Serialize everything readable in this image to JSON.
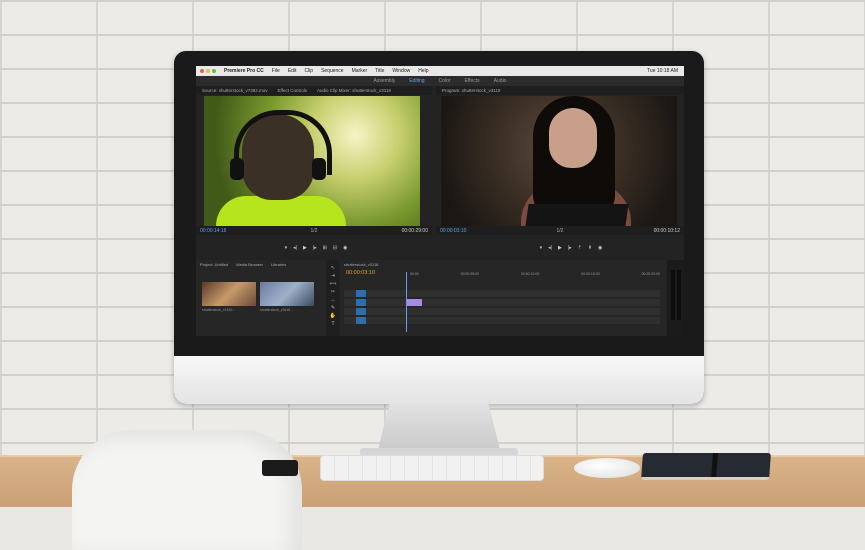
{
  "menu_bar": {
    "app_name": "Premiere Pro CC",
    "items": [
      "File",
      "Edit",
      "Clip",
      "Sequence",
      "Marker",
      "Title",
      "Window",
      "Help"
    ],
    "clock": "Tue 10:18 AM"
  },
  "workspaces": {
    "items": [
      "Assembly",
      "Editing",
      "Color",
      "Effects",
      "Audio"
    ],
    "active": "Editing"
  },
  "source_monitor": {
    "tab": "Source: shutterstock_v7382.mov",
    "tabs_extra": [
      "Effect Controls",
      "Audio Clip Mixer: shutterstock_v3118"
    ],
    "timecode_left": "00:00:14:18",
    "timecode_right": "00:00:29:00",
    "fit": "1/2"
  },
  "program_monitor": {
    "tab": "Program: shutterstock_v3118",
    "timecode_left": "00:00:03:10",
    "timecode_right": "00:00:10:12",
    "fit": "1/2"
  },
  "project_panel": {
    "tabs": [
      "Project: Untitled",
      "Media Browser",
      "Libraries"
    ],
    "search_placeholder": "",
    "items": [
      {
        "name": "shutterstock_v1320...",
        "duration": "15:18"
      },
      {
        "name": "shutterstock_v3118...",
        "duration": "10:20"
      }
    ]
  },
  "timeline": {
    "tab": "shutterstock_v3118",
    "timecode": "00:00:03:10",
    "ruler_ticks": [
      "00:00",
      "00:00:05:00",
      "00:00:10:00",
      "00:00:15:00",
      "00:00:20:00"
    ],
    "tracks": [
      "V2",
      "V1",
      "A1",
      "A2"
    ]
  },
  "colors": {
    "accent": "#5fa0e8",
    "timecode_orange": "#e0a030",
    "clip_violet": "#a78be0"
  }
}
